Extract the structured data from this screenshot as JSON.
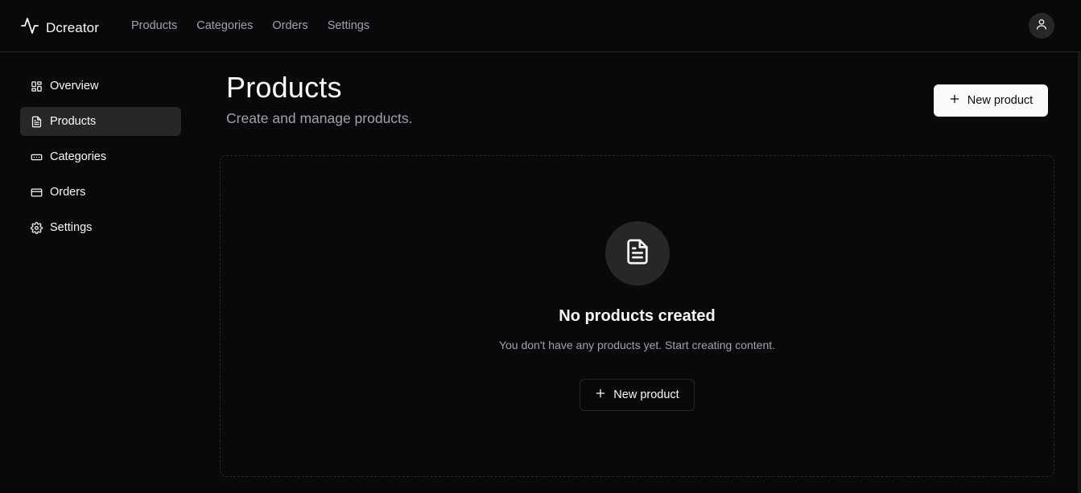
{
  "app": {
    "brand_name": "Dcreator"
  },
  "topnav": {
    "items": [
      {
        "label": "Products"
      },
      {
        "label": "Categories"
      },
      {
        "label": "Orders"
      },
      {
        "label": "Settings"
      }
    ]
  },
  "sidebar": {
    "items": [
      {
        "label": "Overview",
        "icon": "layout-dashboard-icon",
        "active": false
      },
      {
        "label": "Products",
        "icon": "file-text-icon",
        "active": true
      },
      {
        "label": "Categories",
        "icon": "rectangle-ellipsis-icon",
        "active": false
      },
      {
        "label": "Orders",
        "icon": "credit-card-icon",
        "active": false
      },
      {
        "label": "Settings",
        "icon": "gear-icon",
        "active": false
      }
    ]
  },
  "page": {
    "title": "Products",
    "subtitle": "Create and manage products.",
    "new_button_label": "New product"
  },
  "empty_state": {
    "icon": "file-text-icon",
    "title": "No products created",
    "description": "You don't have any products yet. Start creating content.",
    "button_label": "New product"
  },
  "colors": {
    "background": "#09090b",
    "surface": "#27272a",
    "foreground": "#fafafa",
    "muted": "#a1a1aa"
  }
}
